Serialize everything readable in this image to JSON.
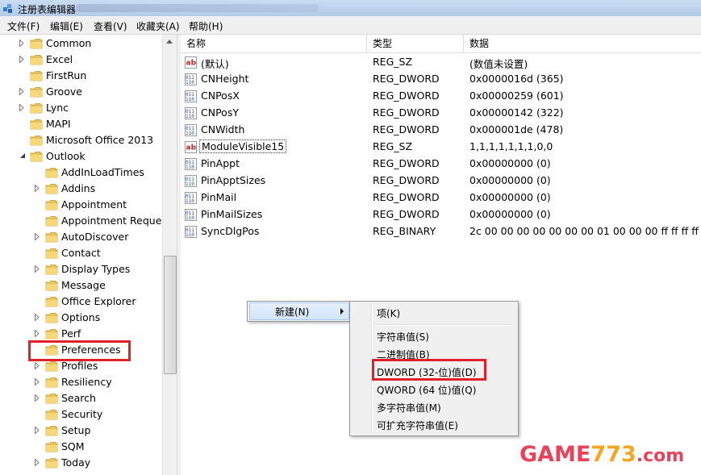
{
  "window": {
    "title": "注册表编辑器"
  },
  "menu": [
    "文件(F)",
    "编辑(E)",
    "查看(V)",
    "收藏夹(A)",
    "帮助(H)"
  ],
  "tree": {
    "items": [
      {
        "label": "Common",
        "level": 1,
        "expander": "collapsed"
      },
      {
        "label": "Excel",
        "level": 1,
        "expander": "collapsed"
      },
      {
        "label": "FirstRun",
        "level": 1,
        "expander": "none"
      },
      {
        "label": "Groove",
        "level": 1,
        "expander": "collapsed"
      },
      {
        "label": "Lync",
        "level": 1,
        "expander": "collapsed"
      },
      {
        "label": "MAPI",
        "level": 1,
        "expander": "none"
      },
      {
        "label": "Microsoft Office 2013",
        "level": 1,
        "expander": "none"
      },
      {
        "label": "Outlook",
        "level": 1,
        "expander": "expanded"
      },
      {
        "label": "AddInLoadTimes",
        "level": 2,
        "expander": "none"
      },
      {
        "label": "Addins",
        "level": 2,
        "expander": "collapsed"
      },
      {
        "label": "Appointment",
        "level": 2,
        "expander": "none"
      },
      {
        "label": "Appointment Reques",
        "level": 2,
        "expander": "none"
      },
      {
        "label": "AutoDiscover",
        "level": 2,
        "expander": "collapsed"
      },
      {
        "label": "Contact",
        "level": 2,
        "expander": "none"
      },
      {
        "label": "Display Types",
        "level": 2,
        "expander": "collapsed"
      },
      {
        "label": "Message",
        "level": 2,
        "expander": "none"
      },
      {
        "label": "Office Explorer",
        "level": 2,
        "expander": "none"
      },
      {
        "label": "Options",
        "level": 2,
        "expander": "collapsed"
      },
      {
        "label": "Perf",
        "level": 2,
        "expander": "collapsed"
      },
      {
        "label": "Preferences",
        "level": 2,
        "expander": "none",
        "selected": true
      },
      {
        "label": "Profiles",
        "level": 2,
        "expander": "collapsed"
      },
      {
        "label": "Resiliency",
        "level": 2,
        "expander": "collapsed"
      },
      {
        "label": "Search",
        "level": 2,
        "expander": "collapsed"
      },
      {
        "label": "Security",
        "level": 2,
        "expander": "none"
      },
      {
        "label": "Setup",
        "level": 2,
        "expander": "collapsed"
      },
      {
        "label": "SQM",
        "level": 2,
        "expander": "none"
      },
      {
        "label": "Today",
        "level": 2,
        "expander": "collapsed"
      }
    ]
  },
  "list": {
    "columns": [
      "名称",
      "类型",
      "数据"
    ],
    "rows": [
      {
        "icon": "string-value-icon",
        "name": "(默认)",
        "type": "REG_SZ",
        "data": "(数值未设置)"
      },
      {
        "icon": "binary-value-icon",
        "name": "CNHeight",
        "type": "REG_DWORD",
        "data": "0x0000016d (365)"
      },
      {
        "icon": "binary-value-icon",
        "name": "CNPosX",
        "type": "REG_DWORD",
        "data": "0x00000259 (601)"
      },
      {
        "icon": "binary-value-icon",
        "name": "CNPosY",
        "type": "REG_DWORD",
        "data": "0x00000142 (322)"
      },
      {
        "icon": "binary-value-icon",
        "name": "CNWidth",
        "type": "REG_DWORD",
        "data": "0x000001de (478)"
      },
      {
        "icon": "string-value-icon",
        "name": "ModuleVisible15",
        "type": "REG_SZ",
        "data": "1,1,1,1,1,1,1,0,0",
        "focused": true
      },
      {
        "icon": "binary-value-icon",
        "name": "PinAppt",
        "type": "REG_DWORD",
        "data": "0x00000000 (0)"
      },
      {
        "icon": "binary-value-icon",
        "name": "PinApptSizes",
        "type": "REG_DWORD",
        "data": "0x00000000 (0)"
      },
      {
        "icon": "binary-value-icon",
        "name": "PinMail",
        "type": "REG_DWORD",
        "data": "0x00000000 (0)"
      },
      {
        "icon": "binary-value-icon",
        "name": "PinMailSizes",
        "type": "REG_DWORD",
        "data": "0x00000000 (0)"
      },
      {
        "icon": "binary-value-icon",
        "name": "SyncDlgPos",
        "type": "REG_BINARY",
        "data": "2c 00 00 00 00 00 00 00 01 00 00 00 ff ff ff ff f..."
      }
    ]
  },
  "context_menu": {
    "new_label": "新建(N)",
    "submenu": [
      "项(K)",
      "字符串值(S)",
      "二进制值(B)",
      "DWORD (32-位)值(D)",
      "QWORD (64 位)值(Q)",
      "多字符串值(M)",
      "可扩充字符串值(E)"
    ]
  },
  "highlight_color": "#e0202a",
  "watermark": {
    "part1": "GAME",
    "part2": "773",
    "part3": ".com"
  }
}
